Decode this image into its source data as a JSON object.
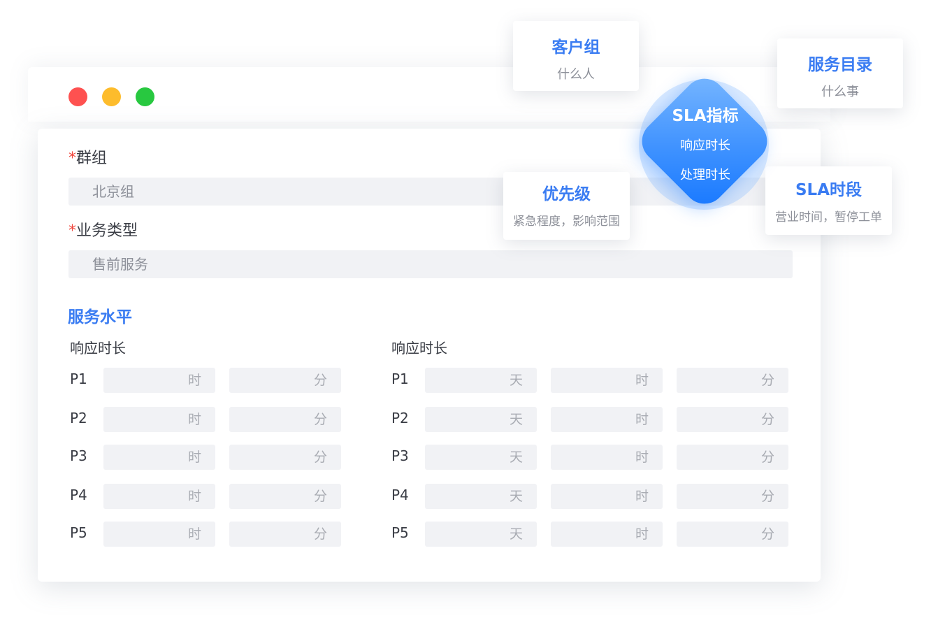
{
  "window": {
    "controls": {
      "close_color": "#fe5150",
      "minimize_color": "#fdbc2c",
      "maximize_color": "#28c840"
    }
  },
  "form": {
    "group": {
      "required_mark": "*",
      "label": "群组",
      "value": "北京组"
    },
    "business_type": {
      "required_mark": "*",
      "label": "业务类型",
      "value": "售前服务"
    }
  },
  "service_level": {
    "title": "服务水平",
    "left": {
      "header": "响应时长",
      "units": [
        "时",
        "分"
      ]
    },
    "right": {
      "header": "响应时长",
      "units": [
        "天",
        "时",
        "分"
      ]
    },
    "priorities": [
      "P1",
      "P2",
      "P3",
      "P4",
      "P5"
    ]
  },
  "cards": {
    "customer_group": {
      "title": "客户组",
      "subtitle": "什么人"
    },
    "service_catalog": {
      "title": "服务目录",
      "subtitle": "什么事"
    },
    "priority": {
      "title": "优先级",
      "subtitle": "紧急程度，影响范围"
    },
    "sla_period": {
      "title": "SLA时段",
      "subtitle": "营业时间，暂停工单"
    },
    "sla_metric": {
      "title": "SLA指标",
      "line1": "响应时长",
      "line2": "处理时长"
    }
  },
  "colors": {
    "accent": "#3a7cf2",
    "required": "#f0463c",
    "input_bg": "#f1f2f5",
    "diamond": "#1677ff"
  }
}
